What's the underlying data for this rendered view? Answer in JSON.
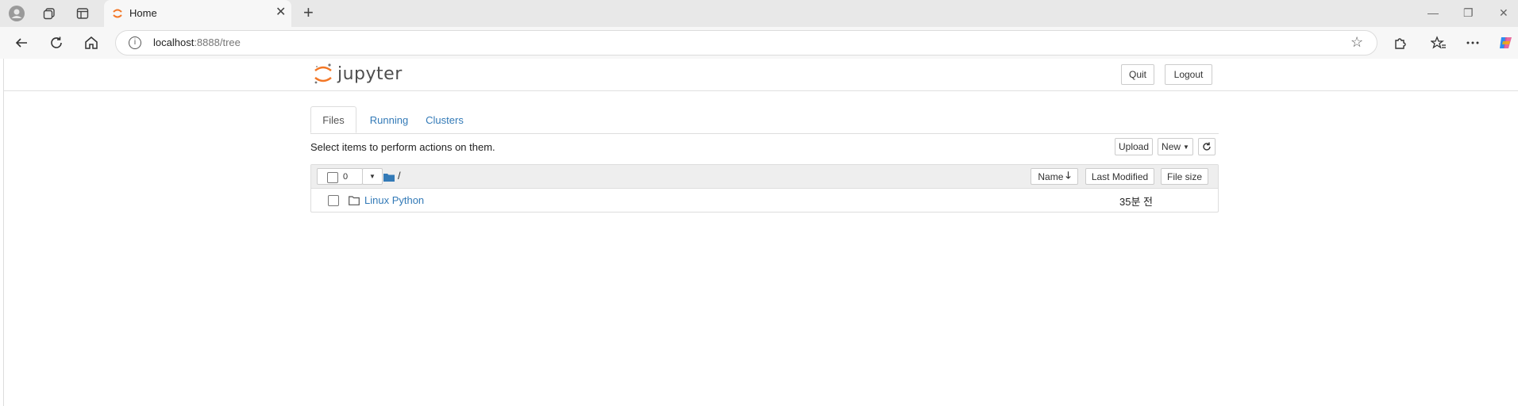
{
  "browser": {
    "tab_title": "Home",
    "url_host": "localhost",
    "url_rest": ":8888/tree"
  },
  "header": {
    "logo_text": "jupyter",
    "quit_label": "Quit",
    "logout_label": "Logout"
  },
  "tabs": [
    {
      "label": "Files"
    },
    {
      "label": "Running"
    },
    {
      "label": "Clusters"
    }
  ],
  "toolbar": {
    "hint": "Select items to perform actions on them.",
    "upload_label": "Upload",
    "new_label": "New",
    "refresh_icon": "refresh-icon"
  },
  "list": {
    "selected_count": "0",
    "breadcrumb": "/",
    "columns": {
      "name": "Name",
      "last_modified": "Last Modified",
      "file_size": "File size"
    },
    "rows": [
      {
        "name": "Linux Python",
        "modified": "35분 전"
      }
    ]
  },
  "colors": {
    "link": "#337ab7",
    "jupyter_orange": "#f37726"
  }
}
